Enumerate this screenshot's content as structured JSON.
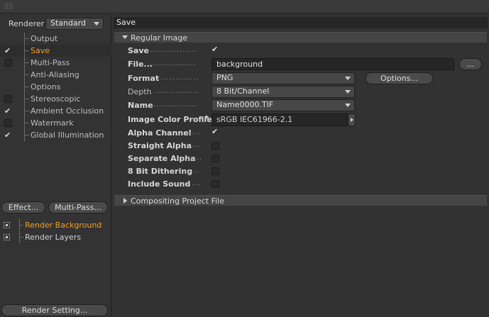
{
  "renderer": {
    "label": "Renderer",
    "value": "Standard"
  },
  "tree": [
    {
      "label": "Output",
      "checkbox": "none",
      "active": false
    },
    {
      "label": "Save",
      "checkbox": "checked",
      "active": true
    },
    {
      "label": "Multi-Pass",
      "checkbox": "box",
      "active": false
    },
    {
      "label": "Anti-Aliasing",
      "checkbox": "none",
      "active": false
    },
    {
      "label": "Options",
      "checkbox": "none",
      "active": false
    },
    {
      "label": "Stereoscopic",
      "checkbox": "box",
      "active": false
    },
    {
      "label": "Ambient Occlusion",
      "checkbox": "checked",
      "active": false
    },
    {
      "label": "Watermark",
      "checkbox": "box",
      "active": false
    },
    {
      "label": "Global Illumination",
      "checkbox": "checked",
      "active": false
    }
  ],
  "buttons": {
    "effect": "Effect...",
    "multipass": "Multi-Pass...",
    "render_setting": "Render Setting..."
  },
  "settings": [
    {
      "label": "Render Background",
      "active": true
    },
    {
      "label": "Render Layers",
      "active": false
    }
  ],
  "panel": {
    "title": "Save",
    "group1": "Regular Image",
    "group2": "Compositing Project File",
    "save": {
      "label": "Save",
      "checked": true
    },
    "file": {
      "label": "File...",
      "value": "background",
      "browse": "..."
    },
    "format": {
      "label": "Format",
      "value": "PNG",
      "options_button": "Options..."
    },
    "depth": {
      "label": "Depth",
      "value": "8 Bit/Channel"
    },
    "name": {
      "label": "Name",
      "value": "Name0000.TIF"
    },
    "color_profile": {
      "label": "Image Color Profile",
      "value": "sRGB IEC61966-2.1"
    },
    "alpha_channel": {
      "label": "Alpha Channel",
      "checked": true
    },
    "straight_alpha": {
      "label": "Straight Alpha",
      "checked": false
    },
    "separate_alpha": {
      "label": "Separate Alpha",
      "checked": false
    },
    "dithering": {
      "label": "8 Bit Dithering",
      "checked": false
    },
    "include_sound": {
      "label": "Include Sound",
      "checked": false
    }
  },
  "colors": {
    "accent": "#f0a020",
    "background": "#323232",
    "header": "#262626"
  }
}
